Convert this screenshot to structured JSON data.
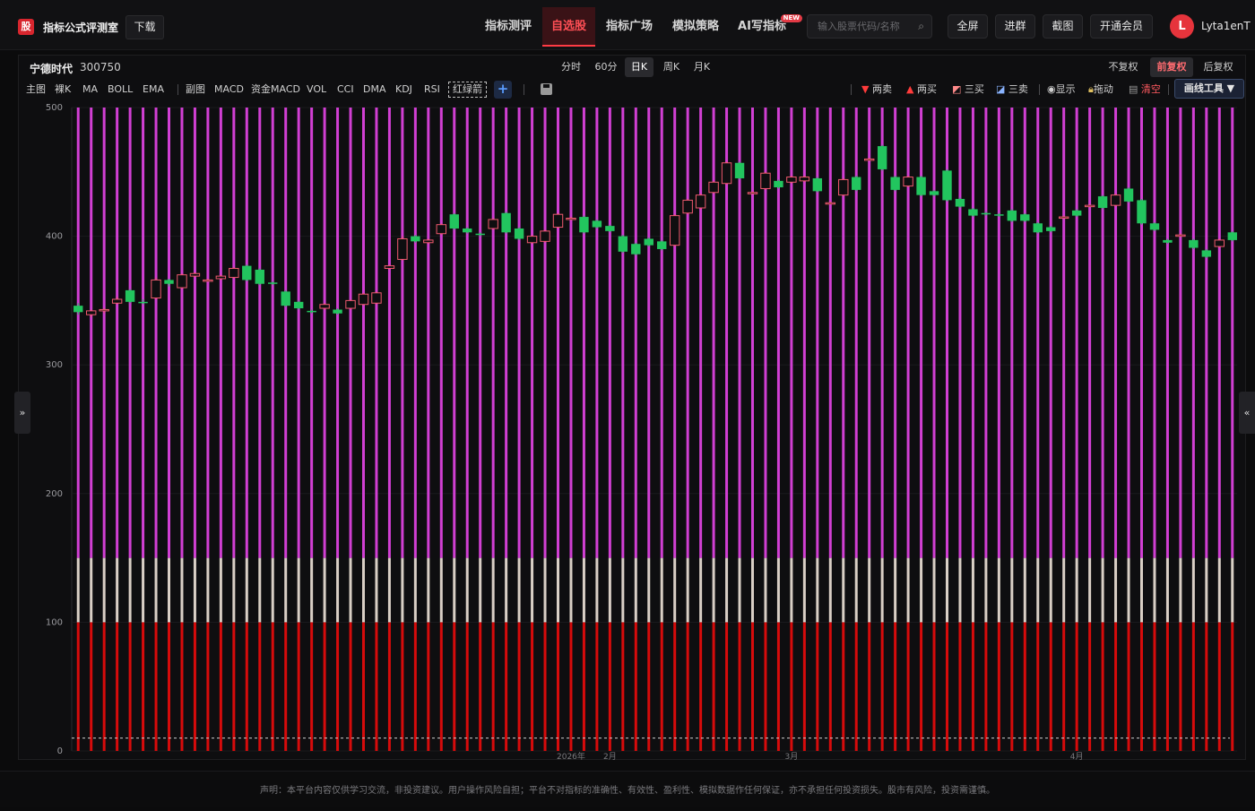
{
  "header": {
    "logo_char": "股",
    "brand": "指标公式评测室",
    "download": "下载",
    "nav": [
      {
        "label": "指标测评",
        "active": false
      },
      {
        "label": "自选股",
        "active": true
      },
      {
        "label": "指标广场",
        "active": false
      },
      {
        "label": "模拟策略",
        "active": false
      },
      {
        "label": "AI写指标",
        "active": false,
        "badge": "NEW"
      }
    ],
    "search_placeholder": "输入股票代码/名称",
    "buttons": [
      "全屏",
      "进群",
      "截图",
      "开通会员"
    ],
    "avatar_letter": "L",
    "username": "Lyta1enT"
  },
  "stock": {
    "name": "宁德时代",
    "code": "300750"
  },
  "periods": [
    {
      "label": "分时",
      "active": false
    },
    {
      "label": "60分",
      "active": false
    },
    {
      "label": "日K",
      "active": true
    },
    {
      "label": "周K",
      "active": false
    },
    {
      "label": "月K",
      "active": false
    }
  ],
  "adjust": [
    {
      "label": "不复权",
      "active": false
    },
    {
      "label": "前复权",
      "active": true
    },
    {
      "label": "后复权",
      "active": false
    }
  ],
  "main_indicators": [
    "主图",
    "裸K",
    "MA",
    "BOLL",
    "EMA"
  ],
  "sub_indicators": [
    "副图",
    "MACD",
    "资金MACD",
    "VOL",
    "CCI",
    "DMA",
    "KDJ",
    "RSI",
    "红绿箭"
  ],
  "add_label": "+",
  "draw_tools": {
    "items": [
      {
        "label": "两卖",
        "icon": "down-triangle-icon"
      },
      {
        "label": "两买",
        "icon": "up-triangle-icon"
      },
      {
        "label": "三买",
        "icon": "line-up-icon"
      },
      {
        "label": "三卖",
        "icon": "line-down-icon"
      },
      {
        "label": "显示",
        "icon": "eye-icon"
      },
      {
        "label": "拖动",
        "icon": "lock-icon"
      },
      {
        "label": "清空",
        "icon": "trash-icon"
      }
    ],
    "menu": "画线工具 ▼"
  },
  "chart_data": {
    "type": "candlestick",
    "y_ticks": [
      0,
      100,
      200,
      300,
      400,
      500
    ],
    "ylim": [
      0,
      500
    ],
    "x_labels": [
      {
        "label": "2026年",
        "index": 38
      },
      {
        "label": "2月",
        "index": 41
      },
      {
        "label": "3月",
        "index": 55
      },
      {
        "label": "4月",
        "index": 77
      }
    ],
    "colors": {
      "up": "#ef5a6e",
      "down": "#22c55e",
      "magenta": "#d13fd3",
      "beige": "#d9cfc5",
      "red": "#d60b0b"
    },
    "bar_bands": {
      "red_top": 100,
      "beige_top": 150,
      "magenta_top": 500
    },
    "dashed_line": 10,
    "candles": [
      {
        "o": 346,
        "c": 341,
        "h": 348,
        "l": 339
      },
      {
        "o": 339,
        "c": 342,
        "h": 343,
        "l": 337
      },
      {
        "o": 342,
        "c": 343,
        "h": 344,
        "l": 340
      },
      {
        "o": 348,
        "c": 351,
        "h": 353,
        "l": 347
      },
      {
        "o": 358,
        "c": 349,
        "h": 359,
        "l": 348
      },
      {
        "o": 349,
        "c": 348,
        "h": 351,
        "l": 347
      },
      {
        "o": 352,
        "c": 366,
        "h": 368,
        "l": 351
      },
      {
        "o": 366,
        "c": 363,
        "h": 367,
        "l": 361
      },
      {
        "o": 360,
        "c": 370,
        "h": 371,
        "l": 359
      },
      {
        "o": 369,
        "c": 371,
        "h": 372,
        "l": 368
      },
      {
        "o": 366,
        "c": 366,
        "h": 367,
        "l": 365
      },
      {
        "o": 367,
        "c": 369,
        "h": 370,
        "l": 366
      },
      {
        "o": 368,
        "c": 375,
        "h": 376,
        "l": 367
      },
      {
        "o": 377,
        "c": 366,
        "h": 378,
        "l": 365
      },
      {
        "o": 374,
        "c": 363,
        "h": 375,
        "l": 362
      },
      {
        "o": 364,
        "c": 363,
        "h": 365,
        "l": 362
      },
      {
        "o": 357,
        "c": 346,
        "h": 358,
        "l": 345
      },
      {
        "o": 349,
        "c": 344,
        "h": 350,
        "l": 343
      },
      {
        "o": 342,
        "c": 341,
        "h": 343,
        "l": 340
      },
      {
        "o": 344,
        "c": 347,
        "h": 348,
        "l": 343
      },
      {
        "o": 343,
        "c": 340,
        "h": 344,
        "l": 339
      },
      {
        "o": 344,
        "c": 350,
        "h": 351,
        "l": 343
      },
      {
        "o": 347,
        "c": 355,
        "h": 356,
        "l": 346
      },
      {
        "o": 348,
        "c": 356,
        "h": 357,
        "l": 347
      },
      {
        "o": 375,
        "c": 377,
        "h": 378,
        "l": 374
      },
      {
        "o": 382,
        "c": 398,
        "h": 400,
        "l": 381
      },
      {
        "o": 400,
        "c": 396,
        "h": 401,
        "l": 395
      },
      {
        "o": 395,
        "c": 397,
        "h": 398,
        "l": 394
      },
      {
        "o": 402,
        "c": 409,
        "h": 410,
        "l": 401
      },
      {
        "o": 417,
        "c": 406,
        "h": 418,
        "l": 405
      },
      {
        "o": 406,
        "c": 403,
        "h": 407,
        "l": 402
      },
      {
        "o": 402,
        "c": 401,
        "h": 403,
        "l": 400
      },
      {
        "o": 406,
        "c": 413,
        "h": 414,
        "l": 405
      },
      {
        "o": 418,
        "c": 403,
        "h": 419,
        "l": 402
      },
      {
        "o": 406,
        "c": 398,
        "h": 407,
        "l": 397
      },
      {
        "o": 395,
        "c": 400,
        "h": 401,
        "l": 394
      },
      {
        "o": 396,
        "c": 404,
        "h": 405,
        "l": 395
      },
      {
        "o": 407,
        "c": 417,
        "h": 418,
        "l": 406
      },
      {
        "o": 414,
        "c": 414,
        "h": 415,
        "l": 413
      },
      {
        "o": 415,
        "c": 403,
        "h": 416,
        "l": 402
      },
      {
        "o": 412,
        "c": 407,
        "h": 413,
        "l": 406
      },
      {
        "o": 408,
        "c": 404,
        "h": 409,
        "l": 403
      },
      {
        "o": 400,
        "c": 388,
        "h": 401,
        "l": 387
      },
      {
        "o": 394,
        "c": 386,
        "h": 395,
        "l": 385
      },
      {
        "o": 398,
        "c": 393,
        "h": 399,
        "l": 392
      },
      {
        "o": 396,
        "c": 390,
        "h": 397,
        "l": 389
      },
      {
        "o": 393,
        "c": 416,
        "h": 417,
        "l": 392
      },
      {
        "o": 418,
        "c": 428,
        "h": 429,
        "l": 417
      },
      {
        "o": 422,
        "c": 432,
        "h": 433,
        "l": 421
      },
      {
        "o": 434,
        "c": 442,
        "h": 443,
        "l": 433
      },
      {
        "o": 441,
        "c": 457,
        "h": 458,
        "l": 440
      },
      {
        "o": 457,
        "c": 445,
        "h": 458,
        "l": 444
      },
      {
        "o": 434,
        "c": 434,
        "h": 435,
        "l": 433
      },
      {
        "o": 437,
        "c": 449,
        "h": 450,
        "l": 436
      },
      {
        "o": 443,
        "c": 438,
        "h": 444,
        "l": 437
      },
      {
        "o": 442,
        "c": 446,
        "h": 447,
        "l": 441
      },
      {
        "o": 443,
        "c": 446,
        "h": 447,
        "l": 442
      },
      {
        "o": 445,
        "c": 435,
        "h": 446,
        "l": 434
      },
      {
        "o": 426,
        "c": 426,
        "h": 427,
        "l": 425
      },
      {
        "o": 432,
        "c": 444,
        "h": 445,
        "l": 431
      },
      {
        "o": 446,
        "c": 436,
        "h": 447,
        "l": 435
      },
      {
        "o": 460,
        "c": 460,
        "h": 461,
        "l": 459
      },
      {
        "o": 470,
        "c": 452,
        "h": 471,
        "l": 451
      },
      {
        "o": 446,
        "c": 436,
        "h": 447,
        "l": 435
      },
      {
        "o": 439,
        "c": 446,
        "h": 447,
        "l": 438
      },
      {
        "o": 446,
        "c": 432,
        "h": 447,
        "l": 431
      },
      {
        "o": 435,
        "c": 432,
        "h": 436,
        "l": 431
      },
      {
        "o": 451,
        "c": 428,
        "h": 452,
        "l": 427
      },
      {
        "o": 429,
        "c": 423,
        "h": 430,
        "l": 422
      },
      {
        "o": 421,
        "c": 416,
        "h": 422,
        "l": 415
      },
      {
        "o": 418,
        "c": 417,
        "h": 419,
        "l": 416
      },
      {
        "o": 417,
        "c": 416,
        "h": 418,
        "l": 415
      },
      {
        "o": 420,
        "c": 412,
        "h": 421,
        "l": 411
      },
      {
        "o": 417,
        "c": 412,
        "h": 418,
        "l": 411
      },
      {
        "o": 410,
        "c": 403,
        "h": 411,
        "l": 402
      },
      {
        "o": 407,
        "c": 404,
        "h": 408,
        "l": 403
      },
      {
        "o": 415,
        "c": 415,
        "h": 416,
        "l": 414
      },
      {
        "o": 420,
        "c": 416,
        "h": 421,
        "l": 415
      },
      {
        "o": 424,
        "c": 424,
        "h": 425,
        "l": 423
      },
      {
        "o": 431,
        "c": 422,
        "h": 432,
        "l": 421
      },
      {
        "o": 424,
        "c": 432,
        "h": 433,
        "l": 423
      },
      {
        "o": 437,
        "c": 427,
        "h": 438,
        "l": 426
      },
      {
        "o": 428,
        "c": 410,
        "h": 429,
        "l": 409
      },
      {
        "o": 410,
        "c": 405,
        "h": 411,
        "l": 404
      },
      {
        "o": 397,
        "c": 395,
        "h": 398,
        "l": 394
      },
      {
        "o": 401,
        "c": 401,
        "h": 402,
        "l": 400
      },
      {
        "o": 397,
        "c": 391,
        "h": 398,
        "l": 390
      },
      {
        "o": 389,
        "c": 384,
        "h": 390,
        "l": 383
      },
      {
        "o": 392,
        "c": 397,
        "h": 398,
        "l": 391
      },
      {
        "o": 403,
        "c": 397,
        "h": 404,
        "l": 396
      }
    ]
  },
  "footer": "声明：本平台内容仅供学习交流，非投资建议。用户操作风险自担；平台不对指标的准确性、有效性、盈利性、模拟数据作任何保证，亦不承担任何投资损失。股市有风险，投资需谨慎。"
}
